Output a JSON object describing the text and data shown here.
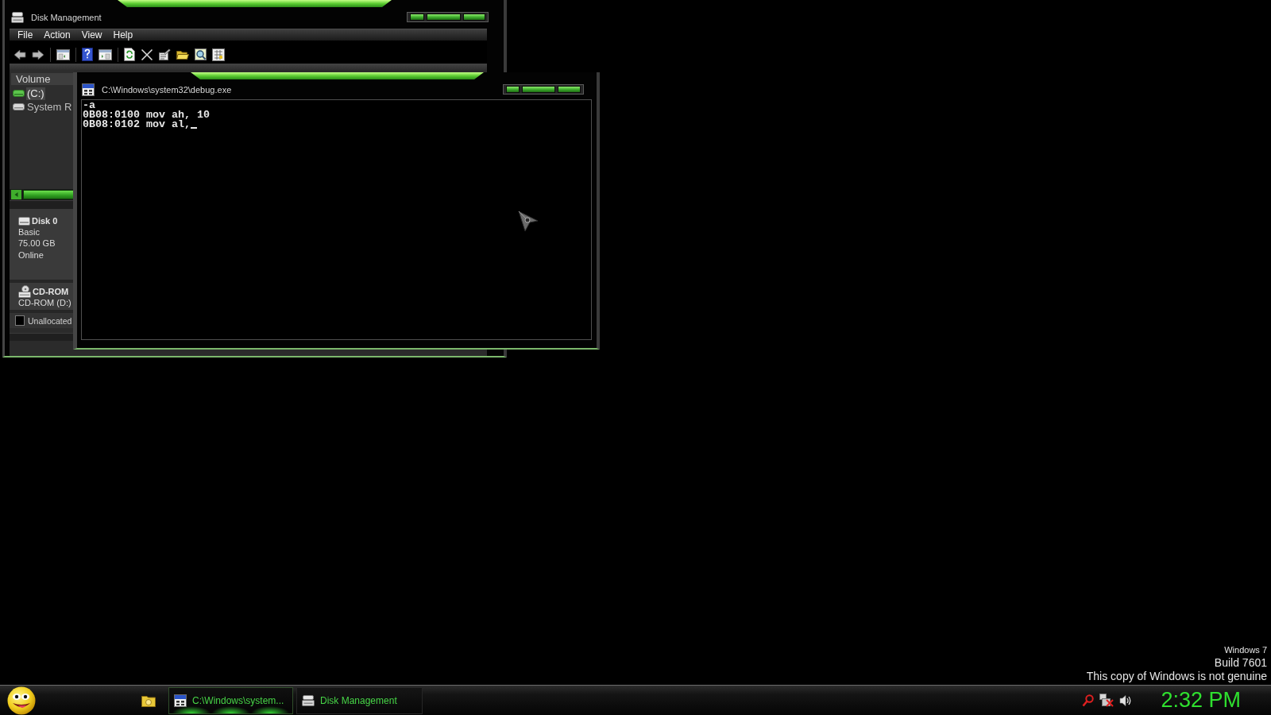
{
  "disk_management_window": {
    "title": "Disk Management",
    "menu": [
      "File",
      "Action",
      "View",
      "Help"
    ],
    "volume_list": {
      "header": "Volume",
      "items": [
        {
          "label": "(C:)",
          "selected": true
        },
        {
          "label": "System R",
          "selected": false
        }
      ]
    },
    "disks": [
      {
        "kind": "disk",
        "name": "Disk 0",
        "details": [
          "Basic",
          "75.00 GB",
          "Online"
        ]
      },
      {
        "kind": "cdrom",
        "name": "CD-ROM",
        "details": [
          "CD-ROM (D:)"
        ]
      }
    ],
    "legend": [
      {
        "label": "Unallocated",
        "color": "#000000"
      }
    ]
  },
  "debug_window": {
    "title": "C:\\Windows\\system32\\debug.exe",
    "console_lines": [
      "-a",
      "0B08:0100 mov ah, 10",
      "0B08:0102 mov al,"
    ]
  },
  "desktop_notice": [
    "Windows 7",
    "Build 7601",
    "This copy of Windows is not genuine"
  ],
  "taskbar": {
    "buttons": [
      {
        "kind": "console",
        "label": "C:\\Windows\\system...",
        "selected": true
      },
      {
        "kind": "disk_management",
        "label": "Disk Management",
        "selected": false
      }
    ],
    "clock": "2:32 PM"
  }
}
